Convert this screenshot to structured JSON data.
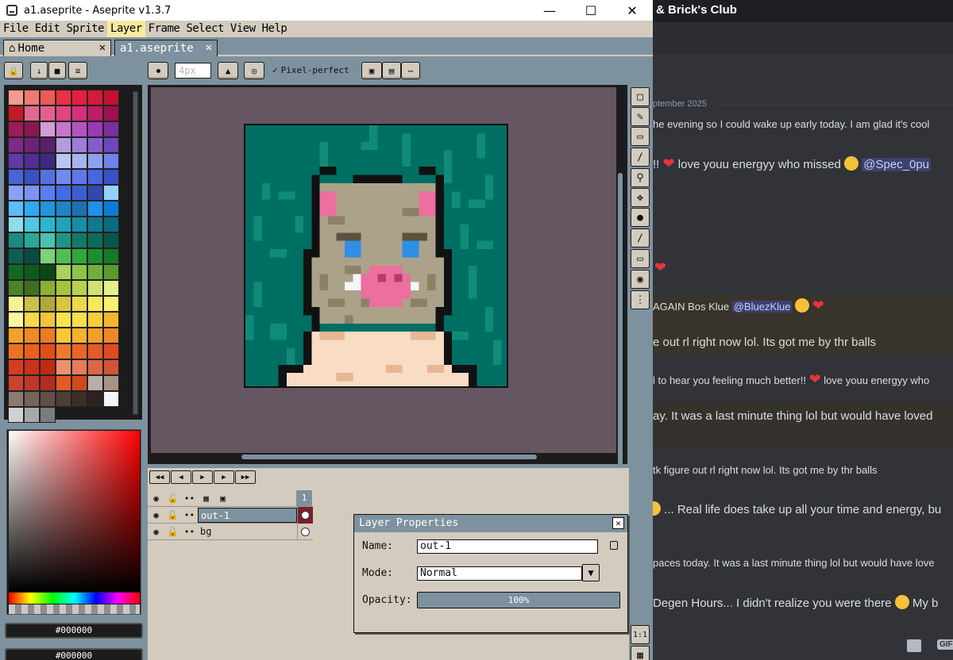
{
  "aseprite": {
    "title": "a1.aseprite - Aseprite v1.3.7",
    "menu": [
      "File",
      "Edit",
      "Sprite",
      "Layer",
      "Frame",
      "Select",
      "View",
      "Help"
    ],
    "tabs": [
      "Home",
      "a1.aseprite"
    ],
    "brush_size": "4px",
    "pixel_perfect": "Pixel-perfect",
    "fg_color_hex": "#000000",
    "bg_color_hex": "#000000",
    "palette": [
      "#f59a8f",
      "#f07a72",
      "#ee5a56",
      "#eb2f48",
      "#e41f3f",
      "#d41b3a",
      "#c41131",
      "#c21a26",
      "#e06a8e",
      "#e5608e",
      "#e0457e",
      "#d6307a",
      "#c11d64",
      "#a01050",
      "#9c1c5a",
      "#8a1850",
      "#d59bd6",
      "#c476cc",
      "#b255c1",
      "#9c3bb5",
      "#7a2f9b",
      "#7e2a88",
      "#6b2379",
      "#5a1f6d",
      "#b39be0",
      "#9e7ed8",
      "#855dc9",
      "#6c47b9",
      "#5e3aa8",
      "#4f2e96",
      "#3f287f",
      "#b9c6f3",
      "#a7b4ef",
      "#8ea0eb",
      "#6e84e6",
      "#4a63d4",
      "#3c50c0",
      "#5770e0",
      "#6f8af0",
      "#5e78ec",
      "#4a66e0",
      "#3850c8",
      "#8aa0f8",
      "#7c93f5",
      "#5b7ef0",
      "#456ae6",
      "#3e5ed0",
      "#3548b0",
      "#93d0fa",
      "#5cbcf5",
      "#2eaaf0",
      "#2295dd",
      "#1e84c6",
      "#1c72b0",
      "#2091e8",
      "#0b7bd4",
      "#8fdcea",
      "#4fc8e0",
      "#2ab7d2",
      "#1ea4bd",
      "#158ea6",
      "#107a8f",
      "#0b6b80",
      "#1c8a80",
      "#2aa896",
      "#4cc1b0",
      "#1f9685",
      "#137868",
      "#0e6b5c",
      "#09574a",
      "#0e5e54",
      "#0b4a42",
      "#7bd37b",
      "#4fbf55",
      "#2fa83a",
      "#1c9030",
      "#157a26",
      "#116a20",
      "#0d5a1a",
      "#094a14",
      "#a9d25e",
      "#8dc44a",
      "#6fb03a",
      "#5a9a2e",
      "#4b8526",
      "#3e7020",
      "#8ab034",
      "#a4c43c",
      "#b8d050",
      "#d2e272",
      "#e7ee8c",
      "#f4f292",
      "#c8c14a",
      "#b0a838",
      "#d8c640",
      "#e8da4c",
      "#f6e85a",
      "#faf070",
      "#fef7a0",
      "#f8d84c",
      "#f4c43a",
      "#f4e54a",
      "#f8e04a",
      "#f6cd3c",
      "#f5b62f",
      "#f3a12a",
      "#ef8a25",
      "#ee7a22",
      "#f8c832",
      "#f6b22c",
      "#f39e28",
      "#ef8824",
      "#ec7420",
      "#e9601c",
      "#e34e18",
      "#ef7a2a",
      "#ea6628",
      "#e55a26",
      "#e04a22",
      "#d83c1e",
      "#cc321a",
      "#c02a16",
      "#ec9270",
      "#e67c5c",
      "#dd6648",
      "#d25438",
      "#c9442e",
      "#bd3a26",
      "#b02e20",
      "#e25c22",
      "#cf4a1c",
      "#b8b0a8",
      "#a69488",
      "#8c7a70",
      "#76645a",
      "#624e46",
      "#4e3c36",
      "#3e2e2a",
      "#2e221e",
      "#f4f4f4",
      "#d0d0d0",
      "#a8a8a8",
      "#7c7c7c"
    ],
    "tools": [
      "rect-marquee",
      "pencil",
      "eraser",
      "eyedropper",
      "zoom",
      "move",
      "paint-bucket",
      "line",
      "rectangle",
      "blur",
      "spray"
    ],
    "timeline": {
      "frame_number": "1",
      "layers": [
        {
          "name": "out-1",
          "selected": true
        },
        {
          "name": "bg",
          "selected": false
        }
      ]
    },
    "dialog": {
      "title": "Layer Properties",
      "name_label": "Name:",
      "name_value": "out-1",
      "mode_label": "Mode:",
      "mode_value": "Normal",
      "opacity_label": "Opacity:",
      "opacity_value": "100%"
    },
    "zoom_label": "1:1"
  },
  "discord": {
    "channel": "& Brick's Club",
    "divider": "ptember 2025",
    "messages": [
      "he evening so I could wake up early today. I am glad it's cool",
      "!!",
      "love youu energyy who missed",
      "@Spec_0pu",
      "AGAIN Bos Klue",
      "@BluezKlue",
      "e out rl right now lol. Its got me by thr balls",
      "l to hear you feeling much better!!",
      "love youu energyy who",
      "ay. It was a last minute thing lol but would have loved",
      "tk figure out rl right now lol. Its got me by thr balls",
      "... Real life does take up all your time and energy, bu",
      "paces today. It was a last minute thing lol but would have love",
      "Degen Hours... I didn't realize you were there",
      "My b"
    ],
    "gif_label": "GIF"
  },
  "colors": {
    "aseprite_bg": "#7d929e",
    "aseprite_panel": "#d3cbbe",
    "canvas_bg": "#665661",
    "sprite_teal": "#006f63",
    "discord_bg": "#313338",
    "mention_bg": "#3c4270",
    "heart": "#e5333f"
  }
}
